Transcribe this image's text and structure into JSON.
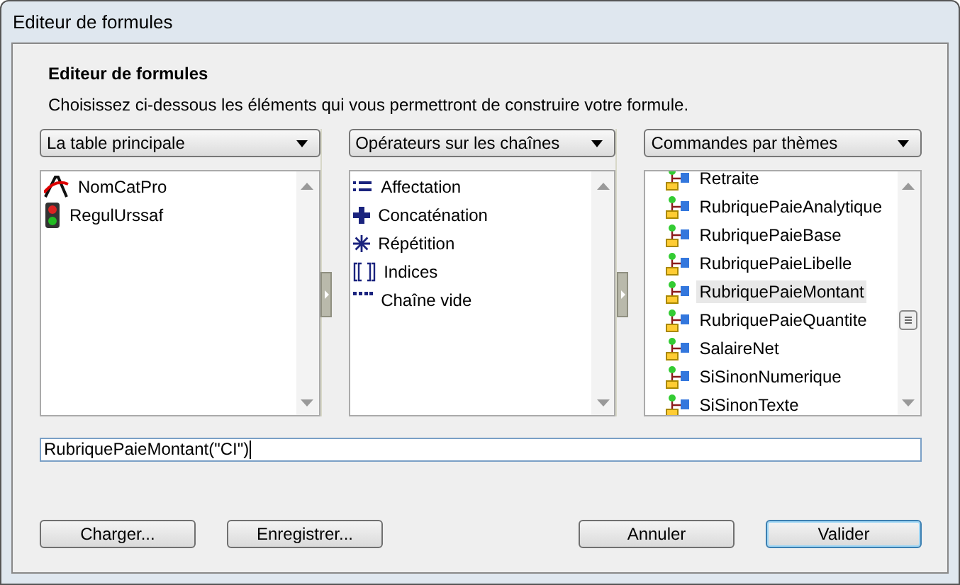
{
  "window": {
    "title": "Editeur de formules"
  },
  "heading": "Editeur de formules",
  "description": "Choisissez ci-dessous les éléments qui vous permettront de construire votre formule.",
  "panels": [
    {
      "dropdown": "La table principale",
      "scrolled": false,
      "items": [
        {
          "label": "NomCatPro",
          "kind": "function",
          "selected": false
        },
        {
          "label": "RegulUrssaf",
          "kind": "traffic-light",
          "selected": false
        }
      ]
    },
    {
      "dropdown": "Opérateurs sur les chaînes",
      "scrolled": false,
      "items": [
        {
          "label": "Affectation",
          "kind": "assign",
          "selected": false
        },
        {
          "label": "Concaténation",
          "kind": "plus",
          "selected": false
        },
        {
          "label": "Répétition",
          "kind": "star",
          "selected": false
        },
        {
          "label": "Indices",
          "kind": "brackets",
          "selected": false
        },
        {
          "label": "Chaîne vide",
          "kind": "dots",
          "selected": false
        }
      ]
    },
    {
      "dropdown": "Commandes par thèmes",
      "scrolled": true,
      "items": [
        {
          "label": "Retraite",
          "kind": "command",
          "selected": false
        },
        {
          "label": "RubriquePaieAnalytique",
          "kind": "command",
          "selected": false
        },
        {
          "label": "RubriquePaieBase",
          "kind": "command",
          "selected": false
        },
        {
          "label": "RubriquePaieLibelle",
          "kind": "command",
          "selected": false
        },
        {
          "label": "RubriquePaieMontant",
          "kind": "command",
          "selected": true
        },
        {
          "label": "RubriquePaieQuantite",
          "kind": "command",
          "selected": false
        },
        {
          "label": "SalaireNet",
          "kind": "command",
          "selected": false
        },
        {
          "label": "SiSinonNumerique",
          "kind": "command",
          "selected": false
        },
        {
          "label": "SiSinonTexte",
          "kind": "command",
          "selected": false
        }
      ]
    }
  ],
  "formula": {
    "value": "RubriquePaieMontant(\"CI\")"
  },
  "buttons": [
    {
      "label": "Charger...",
      "default": false
    },
    {
      "label": "Enregistrer...",
      "default": false
    },
    {
      "label": "Annuler",
      "default": false
    },
    {
      "label": "Valider",
      "default": true
    }
  ]
}
